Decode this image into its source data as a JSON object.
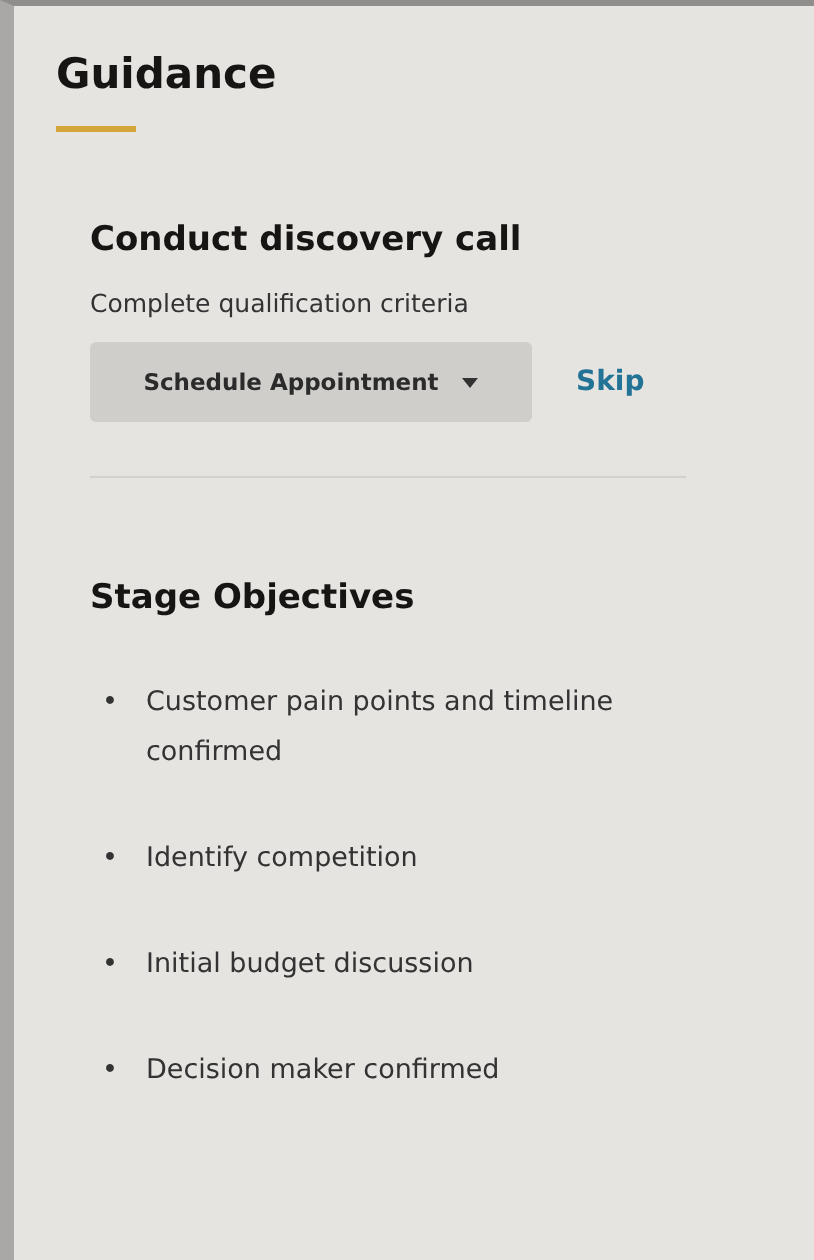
{
  "panel": {
    "title": "Guidance"
  },
  "task": {
    "title": "Conduct discovery call",
    "subtitle": "Complete qualification criteria",
    "action": "Schedule Appointment",
    "skip": "Skip"
  },
  "objectives": {
    "title": "Stage Objectives",
    "items": [
      "Customer pain points and timeline confirmed",
      "Identify competition",
      "Initial budget discussion",
      "Decision maker confirmed"
    ]
  },
  "bullet": "•"
}
